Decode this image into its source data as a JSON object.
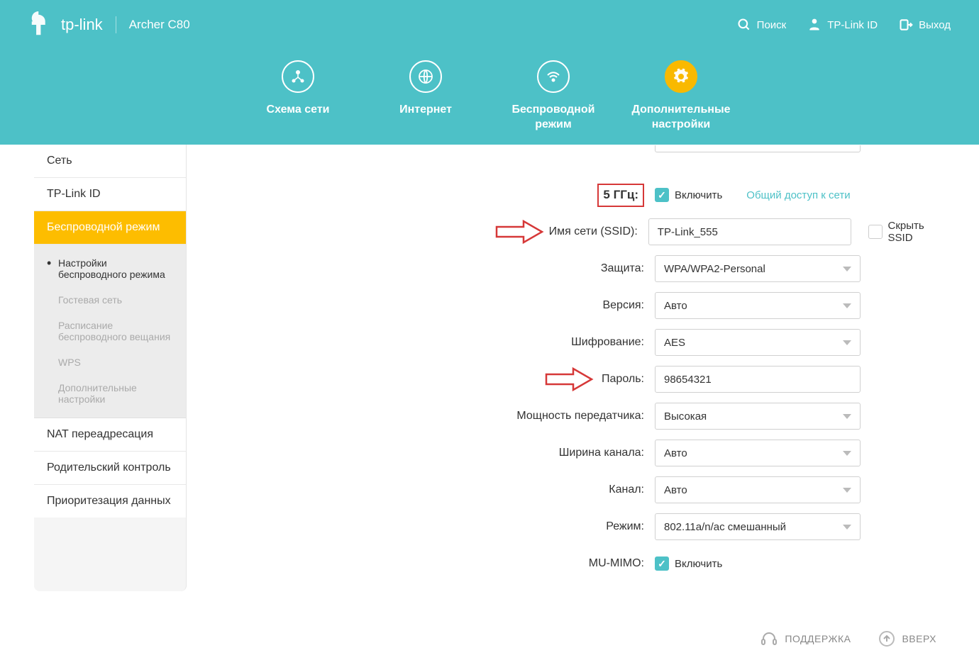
{
  "header": {
    "brand": "tp-link",
    "model": "Archer C80",
    "actions": {
      "search": "Поиск",
      "tplink_id": "TP-Link ID",
      "logout": "Выход"
    }
  },
  "top_nav": {
    "items": [
      {
        "label": "Схема сети"
      },
      {
        "label": "Интернет"
      },
      {
        "label": "Беспроводной\nрежим"
      },
      {
        "label": "Дополнительные\nнастройки"
      }
    ]
  },
  "sidebar": {
    "items": [
      {
        "label": "Сеть"
      },
      {
        "label": "TP-Link ID"
      },
      {
        "label": "Беспроводной режим",
        "active": true
      },
      {
        "label": "NAT переадресация"
      },
      {
        "label": "Родительский контроль"
      },
      {
        "label": "Приоритезация данных"
      }
    ],
    "subitems": [
      {
        "label": "Настройки беспроводного режима"
      },
      {
        "label": "Гостевая сеть"
      },
      {
        "label": "Расписание беспроводного вещания"
      },
      {
        "label": "WPS"
      },
      {
        "label": "Дополнительные настройки"
      }
    ]
  },
  "form": {
    "band_label": "5 ГГц:",
    "enable_label": "Включить",
    "share_label": "Общий доступ к сети",
    "ssid_label": "Имя сети (SSID):",
    "ssid_value": "TP-Link_555",
    "hide_ssid_label": "Скрыть SSID",
    "security_label": "Защита:",
    "security_value": "WPA/WPA2-Personal",
    "version_label": "Версия:",
    "version_value": "Авто",
    "encryption_label": "Шифрование:",
    "encryption_value": "AES",
    "password_label": "Пароль:",
    "password_value": "98654321",
    "tx_power_label": "Мощность передатчика:",
    "tx_power_value": "Высокая",
    "channel_width_label": "Ширина канала:",
    "channel_width_value": "Авто",
    "channel_label": "Канал:",
    "channel_value": "Авто",
    "mode_label": "Режим:",
    "mode_value": "802.11a/n/ac смешанный",
    "mumimo_label": "MU-MIMO:",
    "mumimo_enable": "Включить"
  },
  "footer": {
    "support": "ПОДДЕРЖКА",
    "top": "ВВЕРХ"
  }
}
